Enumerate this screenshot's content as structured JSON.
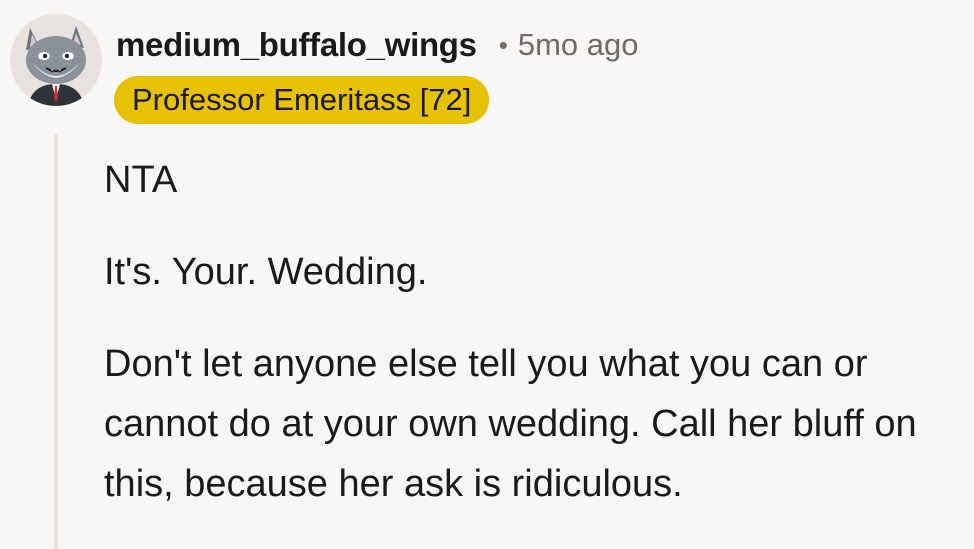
{
  "comment": {
    "username": "medium_buffalo_wings",
    "separator": "•",
    "timestamp": "5mo ago",
    "flair": "Professor Emeritass [72]",
    "avatar_icon": "wolf-avatar-icon",
    "paragraphs": [
      "NTA",
      "It's. Your. Wedding.",
      "Don't let anyone else tell you what you can or cannot do at your own wedding. Call her bluff on this, because her ask is ridiculous."
    ]
  },
  "colors": {
    "background": "#f9f7f5",
    "flair_background": "#e6c100",
    "thread_line": "#e8e4e0",
    "meta_text": "#6f6b68"
  }
}
